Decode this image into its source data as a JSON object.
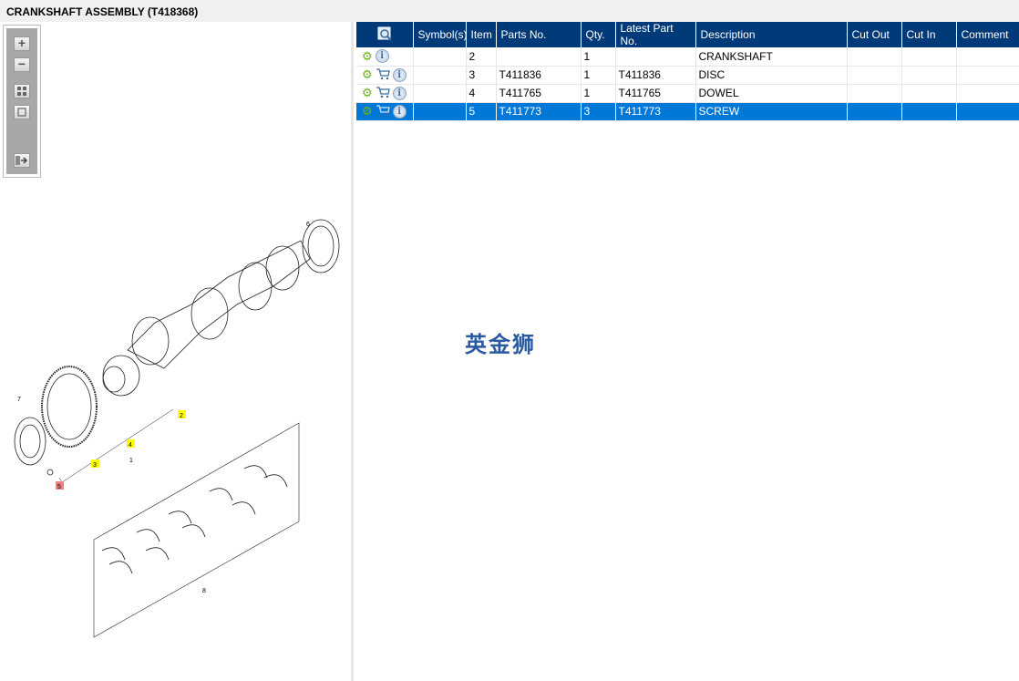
{
  "title": "CRANKSHAFT ASSEMBLY (T418368)",
  "toolbar": {
    "zoom_in": "+",
    "zoom_out": "−"
  },
  "columns": [
    "Symbol(s)",
    "Item",
    "Parts No.",
    "Qty.",
    "Latest Part No.",
    "Description",
    "Cut Out",
    "Cut In",
    "Comment"
  ],
  "rows": [
    {
      "item": "2",
      "part_no": "",
      "qty": "1",
      "latest": "",
      "description": "CRANKSHAFT",
      "cart": false,
      "selected": false
    },
    {
      "item": "3",
      "part_no": "T411836",
      "qty": "1",
      "latest": "T411836",
      "description": "DISC",
      "cart": true,
      "selected": false
    },
    {
      "item": "4",
      "part_no": "T411765",
      "qty": "1",
      "latest": "T411765",
      "description": "DOWEL",
      "cart": true,
      "selected": false
    },
    {
      "item": "5",
      "part_no": "T411773",
      "qty": "3",
      "latest": "T411773",
      "description": "SCREW",
      "cart": true,
      "selected": true
    }
  ],
  "icons": {
    "gear": "⚙",
    "info": "i",
    "cart": "🛒"
  },
  "diagram": {
    "callouts": [
      "1",
      "2",
      "3",
      "4",
      "5",
      "6",
      "7",
      "8"
    ]
  },
  "watermark": "英金狮",
  "colors": {
    "header": "#003a78",
    "selected": "#0078d7",
    "highlight": "#ffff00",
    "highlight_red": "#f08080"
  }
}
